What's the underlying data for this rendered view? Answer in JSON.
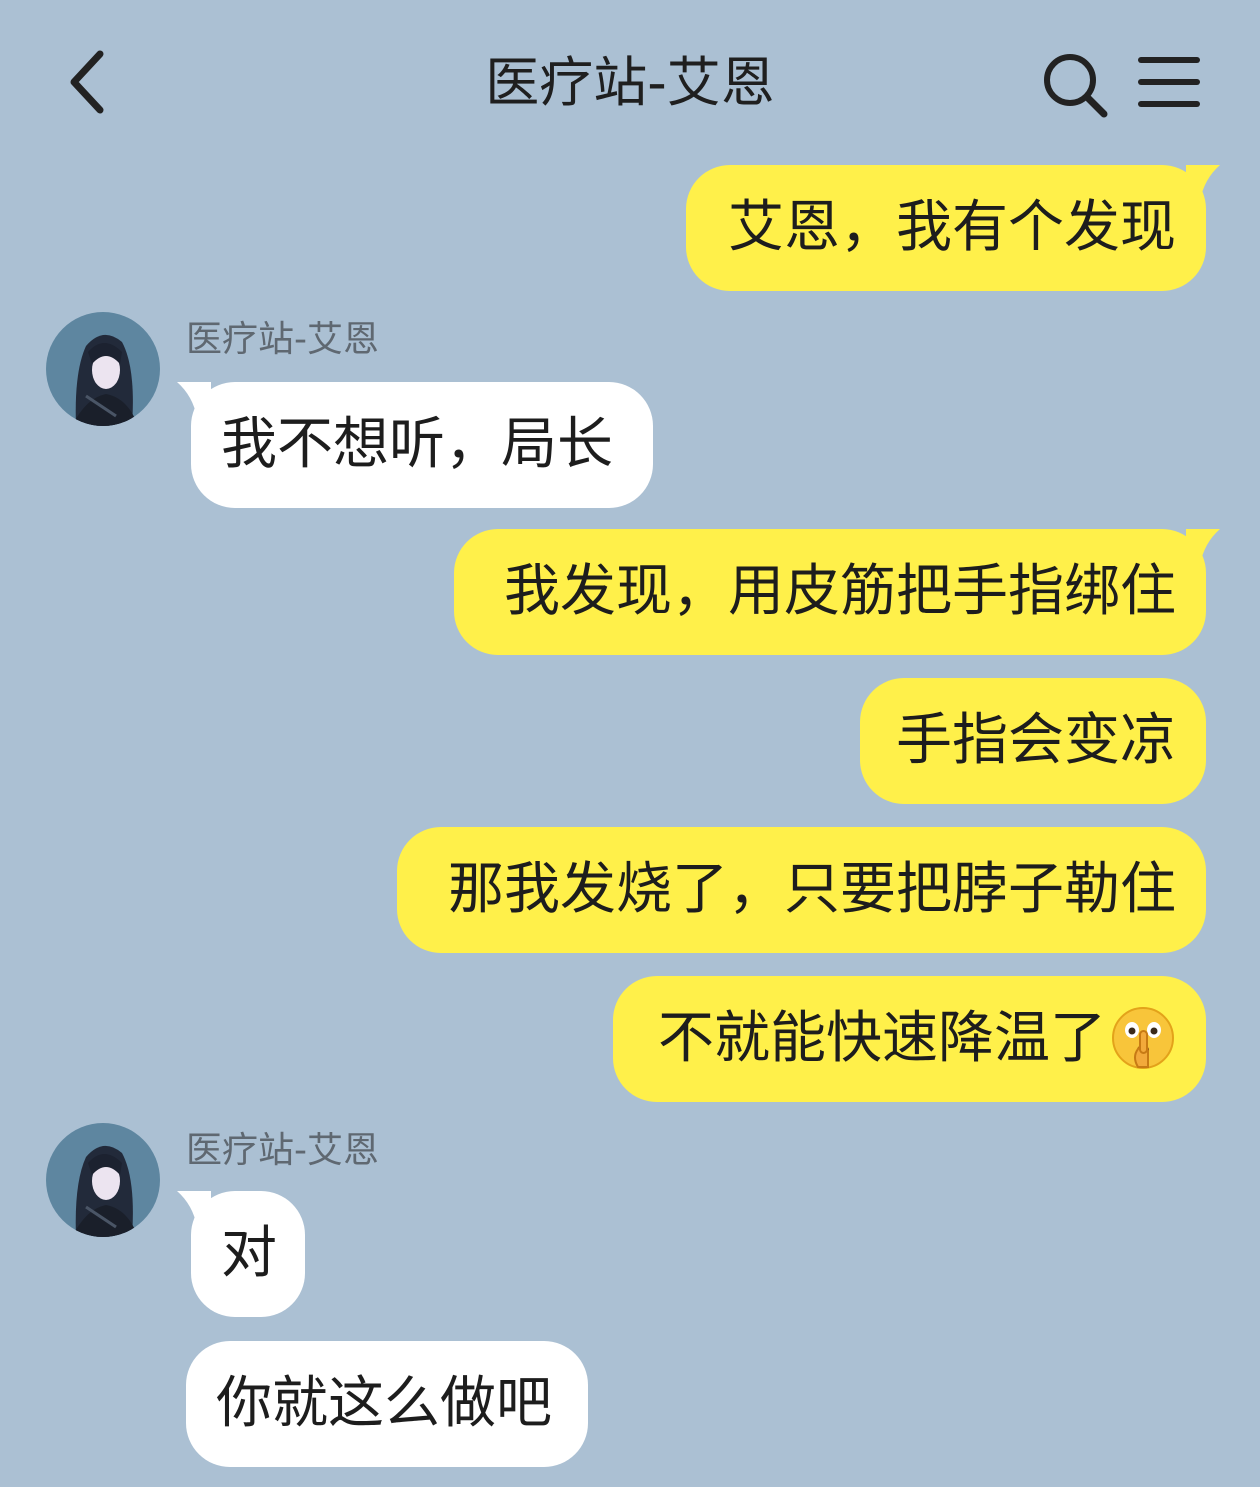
{
  "header": {
    "title": "医疗站-艾恩",
    "back_icon": "chevron-left-icon",
    "search_icon": "search-icon",
    "menu_icon": "hamburger-menu-icon"
  },
  "colors": {
    "background": "#abc0d3",
    "outgoing_bubble": "#fff04a",
    "incoming_bubble": "#ffffff"
  },
  "messages": [
    {
      "direction": "outgoing",
      "text": "艾恩，我有个发现"
    },
    {
      "direction": "incoming",
      "sender": "医疗站-艾恩",
      "text": "我不想听，局长"
    },
    {
      "direction": "outgoing",
      "text": "我发现，用皮筋把手指绑住"
    },
    {
      "direction": "outgoing",
      "text": "手指会变凉"
    },
    {
      "direction": "outgoing",
      "text": "那我发烧了，只要把脖子勒住"
    },
    {
      "direction": "outgoing",
      "text": "不就能快速降温了",
      "emoji": "shushing-face-emoji"
    },
    {
      "direction": "incoming",
      "sender": "医疗站-艾恩",
      "text": "对"
    },
    {
      "direction": "incoming",
      "text": "你就这么做吧"
    }
  ]
}
